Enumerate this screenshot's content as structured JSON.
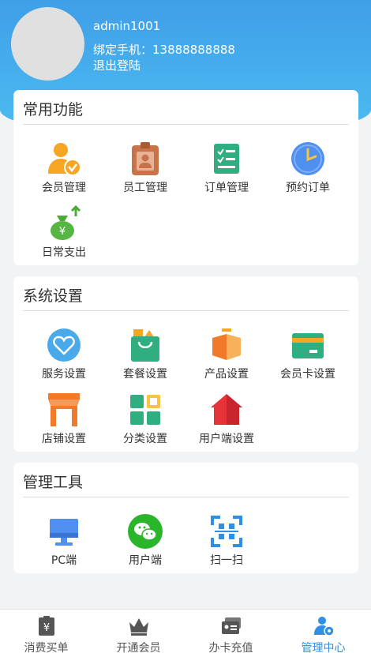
{
  "profile": {
    "username": "admin1001",
    "phone_line": "绑定手机：13888888888",
    "logout_label": "退出登陆"
  },
  "sections": [
    {
      "title": "常用功能",
      "items": [
        {
          "label": "会员管理",
          "icon": "member-manage-icon"
        },
        {
          "label": "员工管理",
          "icon": "staff-badge-icon"
        },
        {
          "label": "订单管理",
          "icon": "order-checklist-icon"
        },
        {
          "label": "预约订单",
          "icon": "clock-icon"
        },
        {
          "label": "日常支出",
          "icon": "money-bag-icon"
        }
      ]
    },
    {
      "title": "系统设置",
      "items": [
        {
          "label": "服务设置",
          "icon": "heart-tag-icon"
        },
        {
          "label": "套餐设置",
          "icon": "shopping-bag-icon"
        },
        {
          "label": "产品设置",
          "icon": "box-icon"
        },
        {
          "label": "会员卡设置",
          "icon": "member-card-icon"
        },
        {
          "label": "店铺设置",
          "icon": "storefront-icon"
        },
        {
          "label": "分类设置",
          "icon": "category-grid-icon"
        },
        {
          "label": "用户端设置",
          "icon": "house-icon"
        }
      ]
    },
    {
      "title": "管理工具",
      "items": [
        {
          "label": "PC端",
          "icon": "monitor-icon"
        },
        {
          "label": "用户端",
          "icon": "wechat-icon"
        },
        {
          "label": "扫一扫",
          "icon": "scan-icon"
        }
      ]
    }
  ],
  "tabbar": {
    "active_index": 3,
    "active_color": "#2f8fe6",
    "items": [
      {
        "label": "消费买单",
        "icon": "receipt-yen-icon"
      },
      {
        "label": "开通会员",
        "icon": "crown-icon"
      },
      {
        "label": "办卡充值",
        "icon": "cards-icon"
      },
      {
        "label": "管理中心",
        "icon": "admin-gear-icon"
      }
    ]
  },
  "colors": {
    "header_gradient_top": "#3f9ee8",
    "header_gradient_bottom": "#4dbcf0",
    "page_background": "#f2f3f5"
  }
}
